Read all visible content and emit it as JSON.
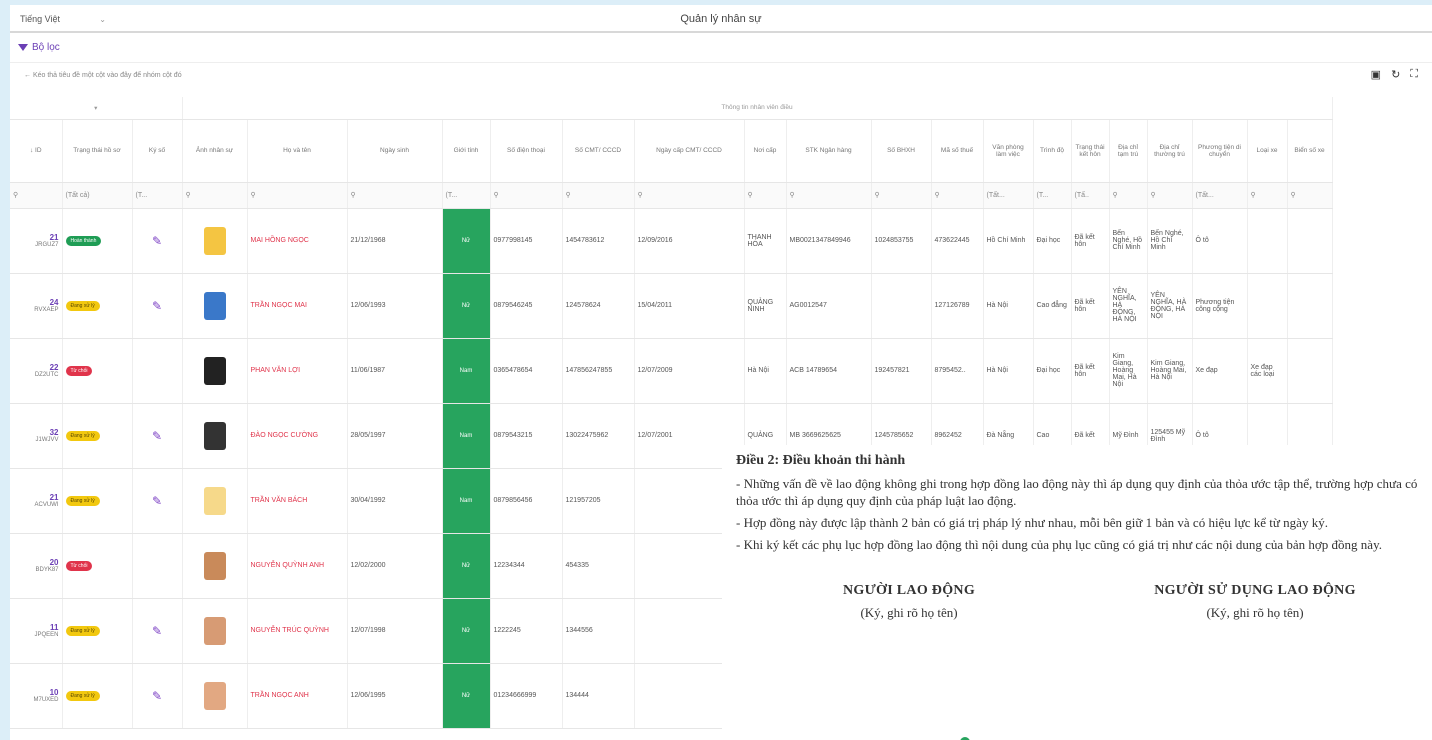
{
  "topbar": {
    "language": "Tiếng Việt",
    "title": "Quản lý nhân sự"
  },
  "filter": {
    "label": "Bộ lọc"
  },
  "hint": "← Kéo thả tiêu đề một cột vào đây để nhóm cột đó",
  "table": {
    "group_header": "Thông tin nhân viên điều",
    "columns": [
      "↓ ID",
      "Trạng thái hồ sơ",
      "Ký số",
      "Ảnh nhân sự",
      "Họ và tên",
      "Ngày sinh",
      "Giới tính",
      "Số điện thoại",
      "Số CMT/ CCCD",
      "Ngày cấp CMT/ CCCD",
      "Nơi cấp",
      "STK Ngân hàng",
      "Số BHXH",
      "Mã số thuế",
      "Văn phòng làm việc",
      "Trình độ",
      "Trạng thái kết hôn",
      "Địa chỉ tạm trú",
      "Địa chỉ thường trú",
      "Phương tiện di chuyển",
      "Loại xe",
      "Biển số xe"
    ],
    "filters": [
      "(Tất cả)",
      "(T...",
      "(T...",
      "(Tất...",
      "(T...",
      "(Tấ..",
      "(Tất..."
    ],
    "rows": [
      {
        "id": "21",
        "code": "JRGUZ7",
        "status": "Hoàn thành",
        "status_color": "green",
        "signed": true,
        "name": "MAI HỒNG NGỌC",
        "dob": "21/12/1968",
        "gender": "Nữ",
        "phone": "0977998145",
        "cmt": "1454783612",
        "issue": "12/09/2016",
        "place": "THANH HÓA",
        "bank": "MB0021347849946",
        "bhxh": "1024853755",
        "tax": "473622445",
        "office": "Hồ Chí Minh",
        "edu": "Đại học",
        "married": "Đã kết hôn",
        "temp": "Bến Nghé, Hồ Chí Minh",
        "perm": "Bến Nghé, Hồ Chí Minh",
        "vehicle": "Ô tô",
        "vtype": "",
        "plate": ""
      },
      {
        "id": "24",
        "code": "RVXAEP",
        "status": "Đang xử lý",
        "status_color": "yellow",
        "signed": true,
        "name": "TRẦN NGỌC MAI",
        "dob": "12/06/1993",
        "gender": "Nữ",
        "phone": "0879546245",
        "cmt": "124578624",
        "issue": "15/04/2011",
        "place": "QUẢNG NINH",
        "bank": "AG0012547",
        "bhxh": "",
        "tax": "127126789",
        "office": "Hà Nội",
        "edu": "Cao đẳng",
        "married": "Đã kết hôn",
        "temp": "YÊN NGHĨA, HÀ ĐÔNG, HÀ NỘI",
        "perm": "YÊN NGHĨA, HÀ ĐÔNG, HÀ NỘI",
        "vehicle": "Phương tiện công cộng",
        "vtype": "",
        "plate": ""
      },
      {
        "id": "22",
        "code": "DZ2UTC",
        "status": "Từ chối",
        "status_color": "red",
        "signed": false,
        "name": "PHAN VĂN LỢI",
        "dob": "11/06/1987",
        "gender": "Nam",
        "phone": "0365478654",
        "cmt": "147856247855",
        "issue": "12/07/2009",
        "place": "Hà Nội",
        "bank": "ACB 14789654",
        "bhxh": "192457821",
        "tax": "8795452..",
        "office": "Hà Nội",
        "edu": "Đại học",
        "married": "Đã kết hôn",
        "temp": "Kim Giang, Hoàng Mai, Hà Nội",
        "perm": "Kim Giang, Hoàng Mai, Hà Nội",
        "vehicle": "Xe đạp",
        "vtype": "Xe đạp các loại",
        "plate": ""
      },
      {
        "id": "32",
        "code": "J1WJVV",
        "status": "Đang xử lý",
        "status_color": "yellow",
        "signed": true,
        "name": "ĐÀO NGỌC CƯỜNG",
        "dob": "28/05/1997",
        "gender": "Nam",
        "phone": "0879543215",
        "cmt": "13022475962",
        "issue": "12/07/2001",
        "place": "QUẢNG",
        "bank": "MB 3669625625",
        "bhxh": "1245785652",
        "tax": "8962452",
        "office": "Đà Nẵng",
        "edu": "Cao",
        "married": "Đã kết",
        "temp": "Mỹ Đình",
        "perm": "125455 Mỹ Đình",
        "vehicle": "Ô tô",
        "vtype": "",
        "plate": ""
      },
      {
        "id": "21",
        "code": "ACVUWI",
        "status": "Đang xử lý",
        "status_color": "yellow",
        "signed": true,
        "name": "TRẦN VĂN BÁCH",
        "dob": "30/04/1992",
        "gender": "Nam",
        "phone": "0879856456",
        "cmt": "121957205",
        "issue": "",
        "place": "",
        "bank": "",
        "bhxh": "",
        "tax": "",
        "office": "",
        "edu": "",
        "married": "",
        "temp": "",
        "perm": "",
        "vehicle": "",
        "vtype": "",
        "plate": ""
      },
      {
        "id": "20",
        "code": "BDYK87",
        "status": "Từ chối",
        "status_color": "red",
        "signed": false,
        "name": "NGUYỄN QUỲNH ANH",
        "dob": "12/02/2000",
        "gender": "Nữ",
        "phone": "12234344",
        "cmt": "454335",
        "issue": "",
        "place": "",
        "bank": "",
        "bhxh": "",
        "tax": "",
        "office": "",
        "edu": "",
        "married": "",
        "temp": "",
        "perm": "",
        "vehicle": "",
        "vtype": "",
        "plate": ""
      },
      {
        "id": "11",
        "code": "JPQEEN",
        "status": "Đang xử lý",
        "status_color": "yellow",
        "signed": true,
        "name": "NGUYỄN TRÚC QUỲNH",
        "dob": "12/07/1998",
        "gender": "Nữ",
        "phone": "1222245",
        "cmt": "1344556",
        "issue": "",
        "place": "",
        "bank": "",
        "bhxh": "",
        "tax": "",
        "office": "",
        "edu": "",
        "married": "",
        "temp": "",
        "perm": "",
        "vehicle": "",
        "vtype": "",
        "plate": ""
      },
      {
        "id": "10",
        "code": "M7UXED",
        "status": "Đang xử lý",
        "status_color": "yellow",
        "signed": true,
        "name": "TRẦN NGỌC ANH",
        "dob": "12/06/1995",
        "gender": "Nữ",
        "phone": "01234666999",
        "cmt": "134444",
        "issue": "",
        "place": "",
        "bank": "",
        "bhxh": "",
        "tax": "",
        "office": "",
        "edu": "",
        "married": "",
        "temp": "",
        "perm": "",
        "vehicle": "",
        "vtype": "",
        "plate": ""
      }
    ]
  },
  "doc": {
    "heading": "Điều 2: Điều khoản thi hành",
    "p1": "- Những vấn đề về lao động không ghi trong hợp đồng lao động này thì áp dụng quy định của thỏa ước tập thể, trường hợp chưa có thỏa ước thì áp dụng quy định của pháp luật lao động.",
    "p2": "- Hợp đồng này được lập thành 2 bản có giá trị pháp lý như nhau, mỗi bên giữ 1 bản và có hiệu lực kể từ ngày ký.",
    "p3": "- Khi ký kết các phụ lục hợp đồng lao động thì nội dung của phụ lục cũng có giá trị như các nội dung của bản hợp đồng này.",
    "sig_left_title": "NGƯỜI LAO ĐỘNG",
    "sig_left_sub": "(Ký, ghi rõ họ tên)",
    "sig_right_title": "NGƯỜI SỬ DỤNG LAO ĐỘNG",
    "sig_right_sub": "(Ký, ghi rõ họ tên)"
  },
  "colors": {
    "accent": "#6b3fb5",
    "green": "#1f9d55",
    "yellow": "#f2c80f",
    "red": "#e0344b"
  }
}
